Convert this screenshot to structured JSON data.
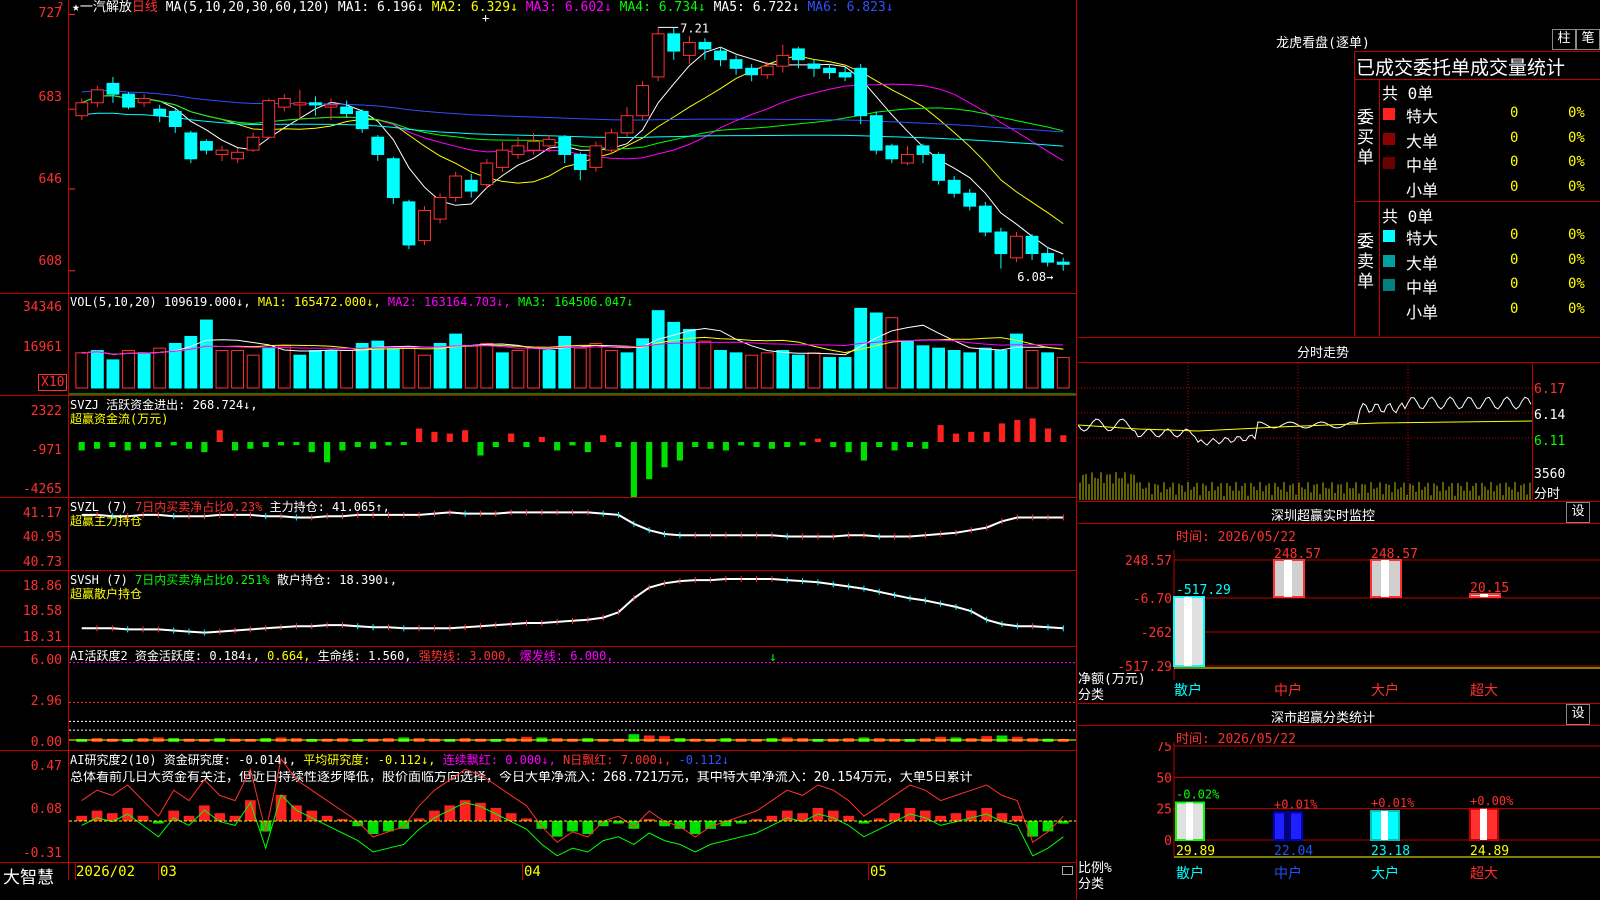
{
  "header": {
    "star": "★",
    "stock_name": "一汽解放",
    "period": "日线",
    "ma_legend": [
      {
        "text": "MA(5,10,20,30,60,120)",
        "color": "#ffffff"
      },
      {
        "text": "MA1: 6.196↓",
        "color": "#ffffff"
      },
      {
        "text": "MA2: 6.329↓",
        "color": "#ffff00"
      },
      {
        "text": "MA3: 6.602↓",
        "color": "#ff00ff"
      },
      {
        "text": "MA4: 6.734↓",
        "color": "#00ff00"
      },
      {
        "text": "MA5: 6.722↓",
        "color": "#ffffff"
      },
      {
        "text": "MA6: 6.823↓",
        "color": "#3050ff"
      }
    ]
  },
  "price_axis": [
    "727",
    "683",
    "646",
    "608"
  ],
  "price_annotations": {
    "high": "7.21",
    "low": "6.08"
  },
  "vol_axis": [
    "34346",
    "16961",
    "X10"
  ],
  "vol_legend": [
    {
      "text": "VOL(5,10,20)",
      "color": "#ffffff"
    },
    {
      "text": "109619.000↓,",
      "color": "#ffffff"
    },
    {
      "text": "MA1: 165472.000↓,",
      "color": "#ffff00"
    },
    {
      "text": "MA2: 163164.703↓,",
      "color": "#ff00ff"
    },
    {
      "text": "MA3: 164506.047↓",
      "color": "#00ff00"
    }
  ],
  "svzj_axis": [
    "2322",
    "-971",
    "-4265"
  ],
  "svzj_legend": [
    {
      "text": "SVZJ  活跃资金进出: 268.724↓,",
      "color": "#ffffff"
    }
  ],
  "svzj_sub": "超赢资金流(万元)",
  "svzl_axis": [
    "41.17",
    "40.95",
    "40.73"
  ],
  "svzl_legend": [
    {
      "text": "SVZL (7)",
      "color": "#ffffff"
    },
    {
      "text": "7日内买卖净占比0.23%",
      "color": "#ff3030"
    },
    {
      "text": "主力持仓: 41.065↑,",
      "color": "#ffffff"
    }
  ],
  "svzl_sub": "超赢主力持仓",
  "svsh_axis": [
    "18.86",
    "18.58",
    "18.31"
  ],
  "svsh_legend": [
    {
      "text": "SVSH (7)",
      "color": "#ffffff"
    },
    {
      "text": "7日内买卖净占比0.251%",
      "color": "#00ff00"
    },
    {
      "text": "散户持仓: 18.390↓,",
      "color": "#ffffff"
    }
  ],
  "svsh_sub": "超赢散户持仓",
  "ai1_axis": [
    "6.00",
    "2.96",
    "0.00"
  ],
  "ai1_legend": [
    {
      "text": "AI活跃度2 资金活跃度: 0.184↓,",
      "color": "#ffffff"
    },
    {
      "text": "0.664,",
      "color": "#ffff00"
    },
    {
      "text": "生命线: 1.560,",
      "color": "#ffffff"
    },
    {
      "text": "强势线: 3.000,",
      "color": "#ff3030"
    },
    {
      "text": "爆发线: 6.000,",
      "color": "#ff00ff"
    }
  ],
  "ai2_axis": [
    "0.47",
    "0.08",
    "-0.31"
  ],
  "ai2_legend": [
    {
      "text": "AI研究度2(10) 资金研究度: -0.014↓,",
      "color": "#ffffff"
    },
    {
      "text": "平均研究度: -0.112↓,",
      "color": "#ffff00"
    },
    {
      "text": "连续飘红: 0.000↓,",
      "color": "#ff00ff"
    },
    {
      "text": "N日飘红: 7.000↓,",
      "color": "#ff3030"
    },
    {
      "text": "-0.112↓",
      "color": "#3050ff"
    }
  ],
  "ai2_text": "总体看前几日大资金有关注，但近日持续性逐步降低，股价面临方向选择，今日大单净流入：268.721万元，其中特大单净流入：20.154万元，大单5日累计",
  "bottom": {
    "brand": "大智慧",
    "dates": [
      "2026/02",
      "03",
      "04",
      "05"
    ]
  },
  "right": {
    "longhu_title": "龙虎看盘(逐单)",
    "btn_zhu": "柱",
    "btn_bi": "笔",
    "order_header": "已成交委托单成交量统计",
    "buy_title": "委买单",
    "sell_title": "委卖单",
    "buy_total": "共 0单",
    "sell_total": "共 0单",
    "rows": [
      "特大",
      "大单",
      "中单",
      "小单"
    ],
    "zero": "0",
    "pct": "0%",
    "fenshi_title": "分时走势",
    "fenshi_axis": [
      "6.17",
      "6.14",
      "6.11",
      "3560",
      "分时"
    ],
    "sz_title": "深圳超赢实时监控",
    "sz_set": "设",
    "sz_time": "时间: 2026/05/22",
    "sz_axis": [
      "248.57",
      "-6.70",
      "-262",
      "-517.29"
    ],
    "sz_bar_labels": [
      "-517.29",
      "248.57",
      "248.57",
      "20.15"
    ],
    "sz_left_label1": "净额(万元)",
    "sz_left_label2": "分类",
    "cats": [
      "散户",
      "中户",
      "大户",
      "超大"
    ],
    "ss_title": "深市超赢分类统计",
    "ss_set": "设",
    "ss_time": "时间: 2026/05/22",
    "ss_axis": [
      "75",
      "50",
      "25",
      "0"
    ],
    "ss_top_labels": [
      "-0.02%",
      "+0.01%",
      "+0.01%",
      "+0.00%"
    ],
    "ss_values": [
      "29.89",
      "22.04",
      "23.18",
      "24.89"
    ],
    "ss_left_label1": "比例%",
    "ss_left_label2": "分类"
  },
  "chart_data": [
    {
      "type": "candlestick",
      "title": "一汽解放 日线",
      "y_axis_ticks": [
        7.27,
        6.83,
        6.46,
        6.08
      ],
      "ylim": [
        6.0,
        7.3
      ],
      "high_label": 7.21,
      "low_label": 6.08,
      "x_ticks": [
        "2026/02",
        "03",
        "04",
        "05"
      ],
      "candles": [
        {
          "o": 6.8,
          "c": 6.86,
          "h": 6.88,
          "l": 6.78
        },
        {
          "o": 6.86,
          "c": 6.92,
          "h": 6.94,
          "l": 6.84
        },
        {
          "o": 6.95,
          "c": 6.9,
          "h": 6.98,
          "l": 6.86
        },
        {
          "o": 6.9,
          "c": 6.84,
          "h": 6.91,
          "l": 6.83
        },
        {
          "o": 6.86,
          "c": 6.88,
          "h": 6.9,
          "l": 6.84
        },
        {
          "o": 6.83,
          "c": 6.8,
          "h": 6.85,
          "l": 6.77
        },
        {
          "o": 6.82,
          "c": 6.75,
          "h": 6.83,
          "l": 6.72
        },
        {
          "o": 6.72,
          "c": 6.6,
          "h": 6.73,
          "l": 6.58
        },
        {
          "o": 6.68,
          "c": 6.64,
          "h": 6.69,
          "l": 6.62
        },
        {
          "o": 6.62,
          "c": 6.64,
          "h": 6.66,
          "l": 6.59
        },
        {
          "o": 6.6,
          "c": 6.63,
          "h": 6.65,
          "l": 6.58
        },
        {
          "o": 6.64,
          "c": 6.7,
          "h": 6.72,
          "l": 6.63
        },
        {
          "o": 6.7,
          "c": 6.87,
          "h": 6.88,
          "l": 6.69
        },
        {
          "o": 6.84,
          "c": 6.88,
          "h": 6.9,
          "l": 6.82
        },
        {
          "o": 6.85,
          "c": 6.86,
          "h": 6.92,
          "l": 6.78
        },
        {
          "o": 6.86,
          "c": 6.85,
          "h": 6.89,
          "l": 6.8
        },
        {
          "o": 6.84,
          "c": 6.85,
          "h": 6.88,
          "l": 6.78
        },
        {
          "o": 6.84,
          "c": 6.81,
          "h": 6.87,
          "l": 6.79
        },
        {
          "o": 6.82,
          "c": 6.74,
          "h": 6.83,
          "l": 6.72
        },
        {
          "o": 6.7,
          "c": 6.62,
          "h": 6.71,
          "l": 6.59
        },
        {
          "o": 6.6,
          "c": 6.42,
          "h": 6.61,
          "l": 6.39
        },
        {
          "o": 6.4,
          "c": 6.2,
          "h": 6.41,
          "l": 6.18
        },
        {
          "o": 6.22,
          "c": 6.36,
          "h": 6.38,
          "l": 6.2
        },
        {
          "o": 6.32,
          "c": 6.42,
          "h": 6.44,
          "l": 6.3
        },
        {
          "o": 6.42,
          "c": 6.52,
          "h": 6.54,
          "l": 6.4
        },
        {
          "o": 6.5,
          "c": 6.45,
          "h": 6.53,
          "l": 6.42
        },
        {
          "o": 6.48,
          "c": 6.58,
          "h": 6.6,
          "l": 6.46
        },
        {
          "o": 6.56,
          "c": 6.64,
          "h": 6.68,
          "l": 6.54
        },
        {
          "o": 6.62,
          "c": 6.66,
          "h": 6.7,
          "l": 6.6
        },
        {
          "o": 6.64,
          "c": 6.68,
          "h": 6.72,
          "l": 6.62
        },
        {
          "o": 6.66,
          "c": 6.69,
          "h": 6.71,
          "l": 6.63
        },
        {
          "o": 6.7,
          "c": 6.62,
          "h": 6.71,
          "l": 6.58
        },
        {
          "o": 6.62,
          "c": 6.55,
          "h": 6.63,
          "l": 6.5
        },
        {
          "o": 6.56,
          "c": 6.66,
          "h": 6.68,
          "l": 6.54
        },
        {
          "o": 6.64,
          "c": 6.72,
          "h": 6.74,
          "l": 6.62
        },
        {
          "o": 6.72,
          "c": 6.8,
          "h": 6.84,
          "l": 6.7
        },
        {
          "o": 6.8,
          "c": 6.94,
          "h": 6.96,
          "l": 6.78
        },
        {
          "o": 6.98,
          "c": 7.18,
          "h": 7.21,
          "l": 6.96
        },
        {
          "o": 7.18,
          "c": 7.1,
          "h": 7.21,
          "l": 7.06
        },
        {
          "o": 7.08,
          "c": 7.14,
          "h": 7.17,
          "l": 7.04
        },
        {
          "o": 7.14,
          "c": 7.11,
          "h": 7.16,
          "l": 7.06
        },
        {
          "o": 7.1,
          "c": 7.06,
          "h": 7.12,
          "l": 7.03
        },
        {
          "o": 7.06,
          "c": 7.02,
          "h": 7.08,
          "l": 6.99
        },
        {
          "o": 7.02,
          "c": 6.99,
          "h": 7.04,
          "l": 6.96
        },
        {
          "o": 6.99,
          "c": 7.03,
          "h": 7.05,
          "l": 6.97
        },
        {
          "o": 7.03,
          "c": 7.08,
          "h": 7.13,
          "l": 7.0
        },
        {
          "o": 7.11,
          "c": 7.06,
          "h": 7.12,
          "l": 7.02
        },
        {
          "o": 7.04,
          "c": 7.02,
          "h": 7.06,
          "l": 6.98
        },
        {
          "o": 7.02,
          "c": 7.0,
          "h": 7.04,
          "l": 6.97
        },
        {
          "o": 7.0,
          "c": 6.98,
          "h": 7.03,
          "l": 6.96
        },
        {
          "o": 7.02,
          "c": 6.8,
          "h": 7.04,
          "l": 6.76
        },
        {
          "o": 6.8,
          "c": 6.64,
          "h": 6.82,
          "l": 6.62
        },
        {
          "o": 6.66,
          "c": 6.6,
          "h": 6.67,
          "l": 6.58
        },
        {
          "o": 6.58,
          "c": 6.62,
          "h": 6.66,
          "l": 6.57
        },
        {
          "o": 6.66,
          "c": 6.62,
          "h": 6.67,
          "l": 6.58
        },
        {
          "o": 6.62,
          "c": 6.5,
          "h": 6.63,
          "l": 6.48
        },
        {
          "o": 6.5,
          "c": 6.44,
          "h": 6.52,
          "l": 6.42
        },
        {
          "o": 6.44,
          "c": 6.38,
          "h": 6.46,
          "l": 6.36
        },
        {
          "o": 6.38,
          "c": 6.26,
          "h": 6.4,
          "l": 6.24
        },
        {
          "o": 6.26,
          "c": 6.16,
          "h": 6.28,
          "l": 6.09
        },
        {
          "o": 6.14,
          "c": 6.24,
          "h": 6.26,
          "l": 6.12
        },
        {
          "o": 6.24,
          "c": 6.16,
          "h": 6.25,
          "l": 6.13
        },
        {
          "o": 6.16,
          "c": 6.12,
          "h": 6.19,
          "l": 6.1
        },
        {
          "o": 6.12,
          "c": 6.11,
          "h": 6.14,
          "l": 6.08
        }
      ]
    },
    {
      "type": "bar",
      "title": "VOL(5,10,20)",
      "y_axis_ticks": [
        34346,
        16961
      ],
      "unit": "X10",
      "values": [
        15,
        16,
        12,
        16,
        15,
        17,
        19,
        22,
        29,
        16,
        16,
        14,
        17,
        18,
        14,
        16,
        16,
        16,
        19,
        20,
        17,
        17,
        14,
        19,
        23,
        18,
        19,
        15,
        16,
        17,
        16,
        22,
        17,
        19,
        16,
        15,
        21,
        33,
        28,
        25,
        20,
        16,
        15,
        14,
        15,
        16,
        14,
        15,
        13,
        13,
        34,
        32,
        30,
        20,
        18,
        17,
        16,
        15,
        17,
        16,
        23,
        16,
        15,
        13
      ],
      "down": [
        false,
        true,
        true,
        false,
        true,
        false,
        true,
        true,
        true,
        false,
        false,
        false,
        true,
        false,
        true,
        true,
        true,
        false,
        true,
        true,
        true,
        false,
        false,
        true,
        true,
        false,
        false,
        true,
        false,
        false,
        true,
        true,
        false,
        false,
        false,
        true,
        true,
        true,
        true,
        true,
        false,
        true,
        true,
        false,
        false,
        true,
        true,
        false,
        true,
        true,
        true,
        true,
        false,
        true,
        true,
        true,
        true,
        true,
        true,
        true,
        true,
        false,
        true,
        false
      ]
    },
    {
      "type": "bar",
      "title": "超赢资金流(万元)",
      "y_axis_ticks": [
        2322,
        -971,
        -4265
      ],
      "values": [
        -500,
        -400,
        -300,
        -500,
        -400,
        -300,
        -200,
        -400,
        -600,
        700,
        -500,
        -400,
        -300,
        -200,
        -100,
        -600,
        -1200,
        -500,
        -300,
        -400,
        -200,
        -100,
        800,
        600,
        500,
        700,
        -800,
        -300,
        500,
        -300,
        300,
        -500,
        -200,
        -600,
        400,
        -300,
        -4200,
        -2200,
        -1500,
        -1100,
        -300,
        -400,
        -500,
        -200,
        -300,
        -400,
        -300,
        -200,
        200,
        -300,
        -600,
        -1100,
        -300,
        -500,
        -300,
        -400,
        1000,
        500,
        600,
        600,
        1100,
        1300,
        1400,
        800,
        400
      ],
      "note": "approximate per-bar values read from the histogram"
    },
    {
      "type": "line",
      "title": "超赢主力持仓",
      "y_axis_ticks": [
        41.17,
        40.95,
        40.73
      ],
      "values": [
        41.1,
        41.1,
        41.09,
        41.09,
        41.1,
        41.1,
        41.09,
        41.09,
        41.09,
        41.1,
        41.1,
        41.1,
        41.09,
        41.09,
        41.08,
        41.08,
        41.09,
        41.09,
        41.1,
        41.1,
        41.1,
        41.1,
        41.1,
        41.11,
        41.12,
        41.11,
        41.11,
        41.11,
        41.12,
        41.12,
        41.12,
        41.12,
        41.12,
        41.12,
        41.11,
        41.1,
        41.03,
        40.98,
        40.95,
        40.94,
        40.94,
        40.94,
        40.94,
        40.94,
        40.94,
        40.94,
        40.93,
        40.93,
        40.93,
        40.93,
        40.94,
        40.94,
        40.93,
        40.93,
        40.93,
        40.94,
        40.95,
        40.96,
        40.98,
        41.0,
        41.05,
        41.08,
        41.08,
        41.08,
        41.08
      ]
    },
    {
      "type": "line",
      "title": "超赢散户持仓",
      "y_axis_ticks": [
        18.86,
        18.58,
        18.31
      ],
      "values": [
        18.4,
        18.4,
        18.4,
        18.39,
        18.39,
        18.39,
        18.38,
        18.37,
        18.36,
        18.37,
        18.38,
        18.39,
        18.4,
        18.41,
        18.42,
        18.42,
        18.43,
        18.43,
        18.42,
        18.41,
        18.41,
        18.4,
        18.4,
        18.4,
        18.4,
        18.41,
        18.42,
        18.43,
        18.44,
        18.45,
        18.45,
        18.46,
        18.47,
        18.48,
        18.5,
        18.55,
        18.68,
        18.78,
        18.82,
        18.84,
        18.85,
        18.85,
        18.86,
        18.86,
        18.86,
        18.86,
        18.85,
        18.84,
        18.83,
        18.81,
        18.79,
        18.77,
        18.74,
        18.71,
        18.68,
        18.66,
        18.63,
        18.6,
        18.56,
        18.48,
        18.44,
        18.42,
        18.42,
        18.41,
        18.4
      ]
    },
    {
      "type": "bar",
      "title": "AI活跃度2",
      "y_axis_ticks": [
        6.0,
        2.96,
        0.0
      ],
      "reference_lines": [
        {
          "name": "生命线",
          "value": 1.56
        },
        {
          "name": "强势线",
          "value": 3.0
        },
        {
          "name": "爆发线",
          "value": 6.0
        }
      ],
      "values": [
        0.2,
        0.3,
        0.25,
        0.2,
        0.3,
        0.35,
        0.3,
        0.25,
        0.2,
        0.3,
        0.25,
        0.2,
        0.3,
        0.35,
        0.3,
        0.2,
        0.25,
        0.3,
        0.2,
        0.25,
        0.3,
        0.35,
        0.3,
        0.25,
        0.2,
        0.3,
        0.25,
        0.2,
        0.3,
        0.4,
        0.35,
        0.3,
        0.25,
        0.3,
        0.2,
        0.25,
        0.6,
        0.5,
        0.45,
        0.3,
        0.25,
        0.2,
        0.3,
        0.25,
        0.2,
        0.3,
        0.35,
        0.3,
        0.2,
        0.25,
        0.3,
        0.35,
        0.3,
        0.25,
        0.2,
        0.3,
        0.4,
        0.35,
        0.3,
        0.45,
        0.5,
        0.4,
        0.3,
        0.25,
        0.18
      ]
    },
    {
      "type": "bar",
      "title": "AI研究度2(10)",
      "y_axis_ticks": [
        0.47,
        0.08,
        -0.31
      ],
      "values": [
        0.02,
        0.04,
        0.03,
        0.05,
        0.02,
        -0.01,
        0.04,
        0.02,
        0.06,
        0.03,
        0.02,
        0.08,
        -0.04,
        0.1,
        0.06,
        0.04,
        0.02,
        0.0,
        -0.02,
        -0.05,
        -0.04,
        -0.03,
        0.01,
        0.04,
        0.06,
        0.08,
        0.07,
        0.05,
        0.03,
        0.01,
        -0.03,
        -0.06,
        -0.04,
        -0.05,
        -0.02,
        -0.01,
        -0.03,
        0.0,
        -0.02,
        -0.03,
        -0.05,
        -0.03,
        -0.02,
        -0.01,
        0.0,
        0.02,
        0.04,
        0.03,
        0.05,
        0.04,
        0.02,
        -0.01,
        0.01,
        0.03,
        0.05,
        0.04,
        0.02,
        0.03,
        0.04,
        0.05,
        0.03,
        0.02,
        -0.06,
        -0.04,
        -0.01
      ]
    },
    {
      "type": "bar",
      "title": "深圳超赢实时监控",
      "categories": [
        "散户",
        "中户",
        "大户",
        "超大"
      ],
      "values": [
        -517.29,
        248.57,
        248.57,
        20.15
      ],
      "y_axis_ticks": [
        248.57,
        -6.7,
        -262,
        -517.29
      ]
    },
    {
      "type": "bar",
      "title": "深市超赢分类统计",
      "categories": [
        "散户",
        "中户",
        "大户",
        "超大"
      ],
      "values": [
        29.89,
        22.04,
        23.18,
        24.89
      ],
      "changes": [
        "-0.02%",
        "+0.01%",
        "+0.01%",
        "+0.00%"
      ],
      "y_axis_ticks": [
        75,
        50,
        25,
        0
      ]
    }
  ]
}
